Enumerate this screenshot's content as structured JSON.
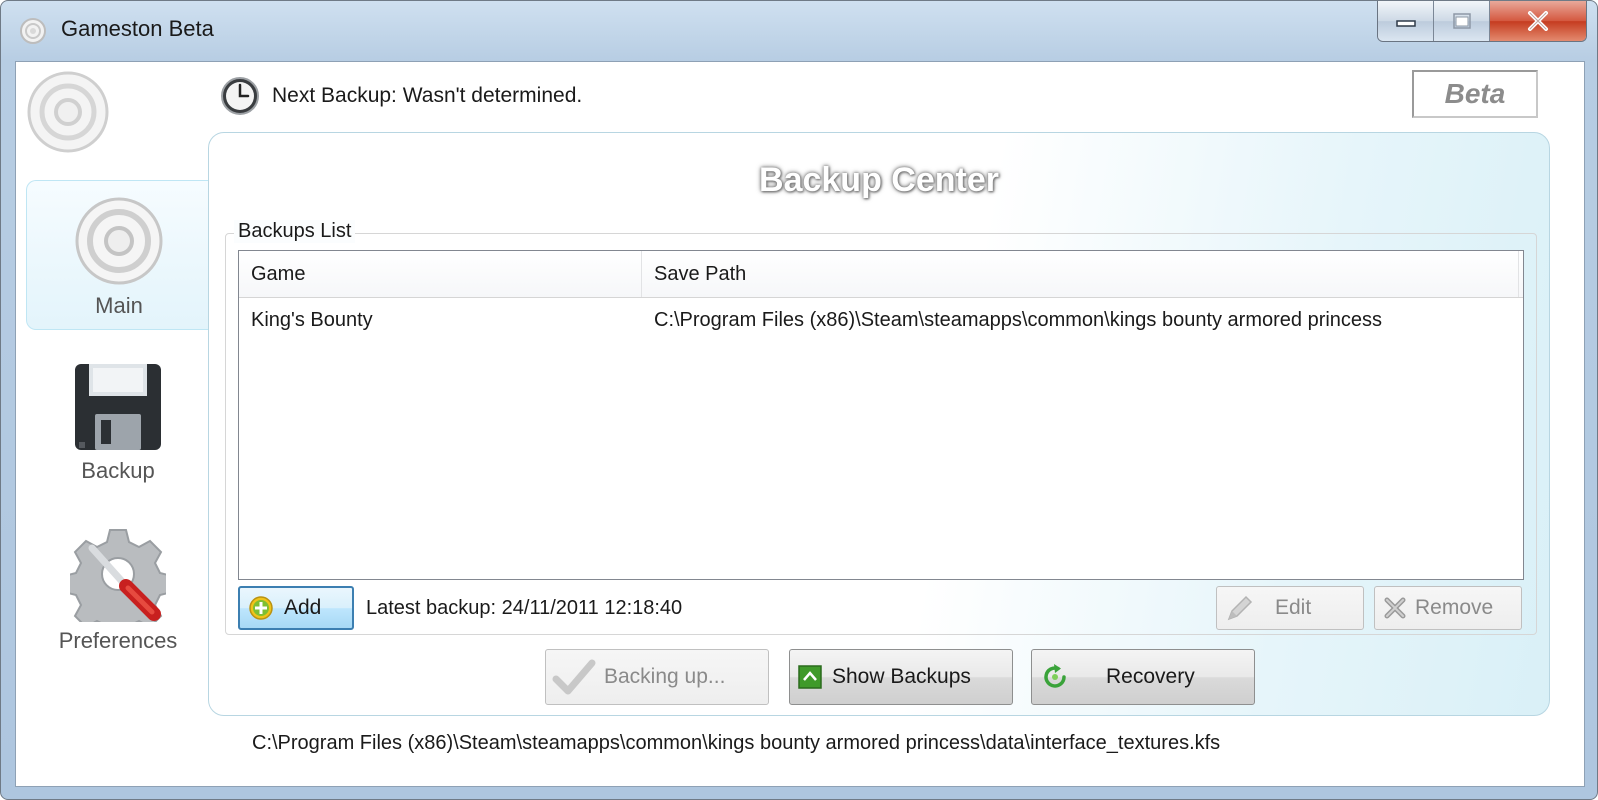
{
  "window": {
    "title": "Gameston Beta",
    "icon": "gameston-logo-icon",
    "controls": [
      "minimize-icon",
      "maximize-icon",
      "close-icon"
    ]
  },
  "sidebar": {
    "items": [
      {
        "label": "Main",
        "icon": "gameston-target-icon",
        "active": true
      },
      {
        "label": "Backup",
        "icon": "floppy-disk-icon",
        "active": false
      },
      {
        "label": "Preferences",
        "icon": "gear-screwdriver-icon",
        "active": false
      }
    ]
  },
  "header": {
    "next_backup": "Next Backup: Wasn't determined.",
    "badge": "Beta"
  },
  "panel": {
    "title": "Backup Center",
    "group_label": "Backups List",
    "columns": [
      "Game",
      "Save Path"
    ],
    "rows": [
      {
        "game": "King's Bounty",
        "path": "C:\\Program Files (x86)\\Steam\\steamapps\\common\\kings bounty armored princess"
      }
    ],
    "add_label": "Add",
    "latest_backup": "Latest backup: 24/11/2011 12:18:40",
    "edit_label": "Edit",
    "remove_label": "Remove",
    "backing_up_label": "Backing up...",
    "show_backups_label": "Show Backups",
    "recovery_label": "Recovery"
  },
  "status": {
    "current_file": "C:\\Program Files (x86)\\Steam\\steamapps\\common\\kings bounty armored princess\\data\\interface_textures.kfs"
  },
  "colors": {
    "accent": "#3c7fb1",
    "panel_tint": "#d9f0f7",
    "close_button": "#c53b1f"
  }
}
